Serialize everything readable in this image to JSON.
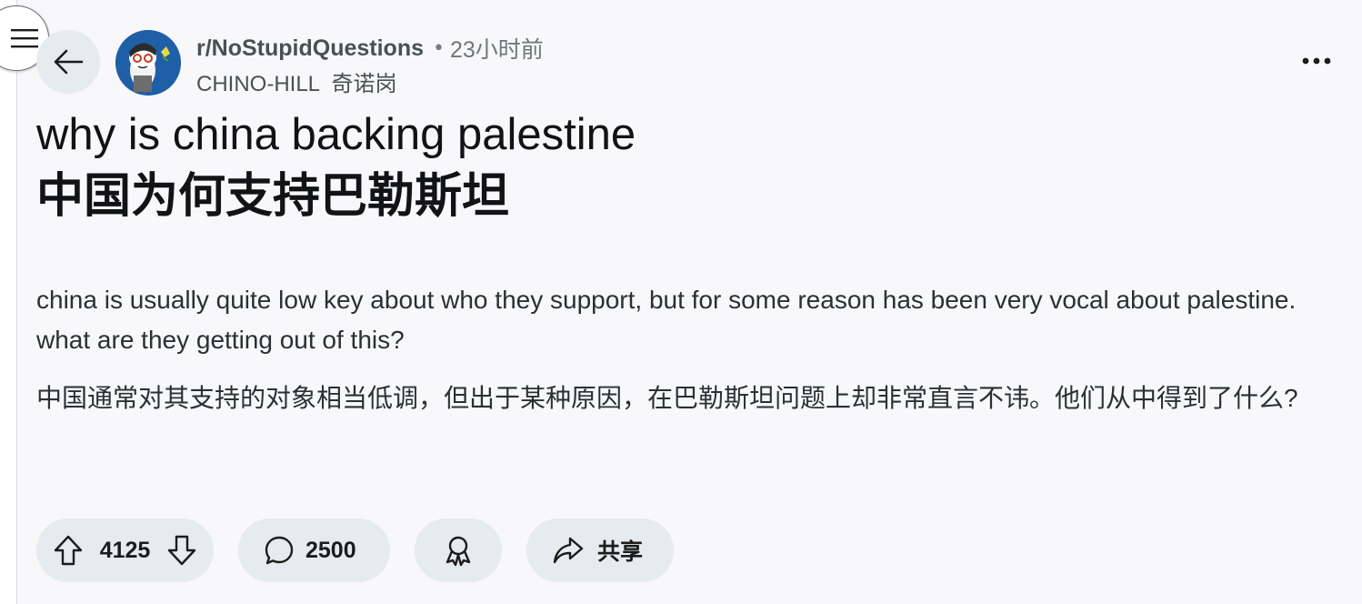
{
  "post": {
    "subreddit": "r/NoStupidQuestions",
    "separator": "•",
    "time_ago": "23小时前",
    "author": "CHINO-HILL  奇诺岗",
    "title_en": "why is china backing palestine",
    "title_zh": "中国为何支持巴勒斯坦",
    "body_en": "china is usually quite low key about who they support, but for some reason has been very vocal about palestine. what are they getting out of this?",
    "body_zh": "中国通常对其支持的对象相当低调，但出于某种原因，在巴勒斯坦问题上却非常直言不讳。他们从中得到了什么?"
  },
  "actions": {
    "vote_count": "4125",
    "comment_count": "2500",
    "share_label": "共享"
  },
  "icons": {
    "menu": "hamburger-menu-icon",
    "back": "arrow-left-icon",
    "more": "more-horizontal-icon",
    "upvote": "arrow-up-icon",
    "downvote": "arrow-down-icon",
    "comment": "speech-bubble-icon",
    "award": "award-icon",
    "share": "share-arrow-icon"
  },
  "colors": {
    "page_background": "#f8f8fa",
    "pill_background": "#e5ebee",
    "avatar_background": "#1f5fa8",
    "text_primary": "#111315",
    "text_secondary": "#70767a"
  }
}
